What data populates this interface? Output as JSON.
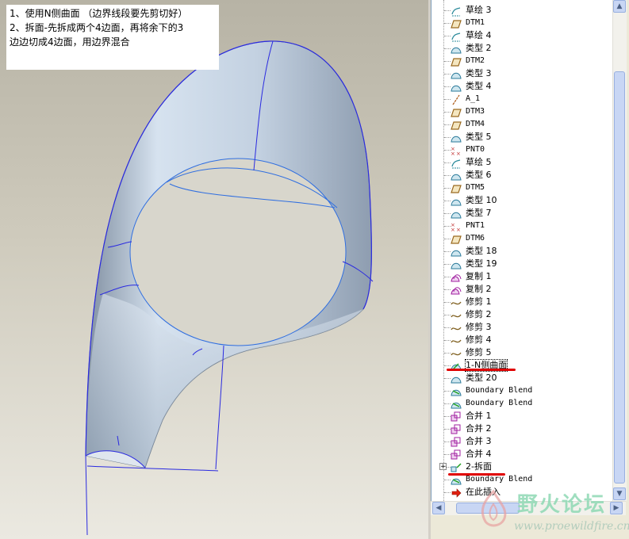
{
  "note": {
    "lines": [
      "1、使用N侧曲面 （边界线段要先剪切好）",
      "2、拆面-先拆成两个4边面，再将余下的3",
      "边边切成4边面，用边界混合"
    ]
  },
  "model_tree": {
    "items": [
      {
        "label": "草绘 3",
        "icon": "sketch-icon"
      },
      {
        "label": "DTM1",
        "icon": "datum-plane-icon"
      },
      {
        "label": "草绘 4",
        "icon": "sketch-icon"
      },
      {
        "label": "类型 2",
        "icon": "surface-icon"
      },
      {
        "label": "DTM2",
        "icon": "datum-plane-icon"
      },
      {
        "label": "类型 3",
        "icon": "surface-icon"
      },
      {
        "label": "类型 4",
        "icon": "surface-icon"
      },
      {
        "label": "A_1",
        "icon": "datum-axis-icon"
      },
      {
        "label": "DTM3",
        "icon": "datum-plane-icon"
      },
      {
        "label": "DTM4",
        "icon": "datum-plane-icon"
      },
      {
        "label": "类型 5",
        "icon": "surface-icon"
      },
      {
        "label": "PNT0",
        "icon": "datum-point-icon"
      },
      {
        "label": "草绘 5",
        "icon": "sketch-icon"
      },
      {
        "label": "类型 6",
        "icon": "surface-icon"
      },
      {
        "label": "DTM5",
        "icon": "datum-plane-icon"
      },
      {
        "label": "类型 10",
        "icon": "surface-icon"
      },
      {
        "label": "类型 7",
        "icon": "surface-icon"
      },
      {
        "label": "PNT1",
        "icon": "datum-point-icon"
      },
      {
        "label": "DTM6",
        "icon": "datum-plane-icon"
      },
      {
        "label": "类型 18",
        "icon": "surface-icon"
      },
      {
        "label": "类型 19",
        "icon": "surface-icon"
      },
      {
        "label": "复制 1",
        "icon": "copy-icon"
      },
      {
        "label": "复制 2",
        "icon": "copy-icon"
      },
      {
        "label": "修剪 1",
        "icon": "trim-icon"
      },
      {
        "label": "修剪 2",
        "icon": "trim-icon"
      },
      {
        "label": "修剪 3",
        "icon": "trim-icon"
      },
      {
        "label": "修剪 4",
        "icon": "trim-icon"
      },
      {
        "label": "修剪 5",
        "icon": "trim-icon"
      },
      {
        "label": "1-N侧曲面",
        "icon": "nsided-surface-icon"
      },
      {
        "label": "类型 20",
        "icon": "surface-icon"
      },
      {
        "label": "Boundary Blend",
        "icon": "boundary-blend-icon"
      },
      {
        "label": "Boundary Blend",
        "icon": "boundary-blend-icon"
      },
      {
        "label": "合并 1",
        "icon": "merge-icon"
      },
      {
        "label": "合并 2",
        "icon": "merge-icon"
      },
      {
        "label": "合并 3",
        "icon": "merge-icon"
      },
      {
        "label": "合并 4",
        "icon": "merge-icon"
      },
      {
        "label": "2-拆面",
        "icon": "split-surface-icon",
        "expander": "+"
      },
      {
        "label": "Boundary Blend",
        "icon": "boundary-blend-icon"
      },
      {
        "label": "在此插入",
        "icon": "insert-here-arrow-icon"
      }
    ]
  },
  "watermark": {
    "title": "野火论坛",
    "url": "www.proewildfire.cn"
  },
  "colors": {
    "surface": "#c9d6e4",
    "edge": "#2a2ae0",
    "highlight": "#e00000"
  }
}
